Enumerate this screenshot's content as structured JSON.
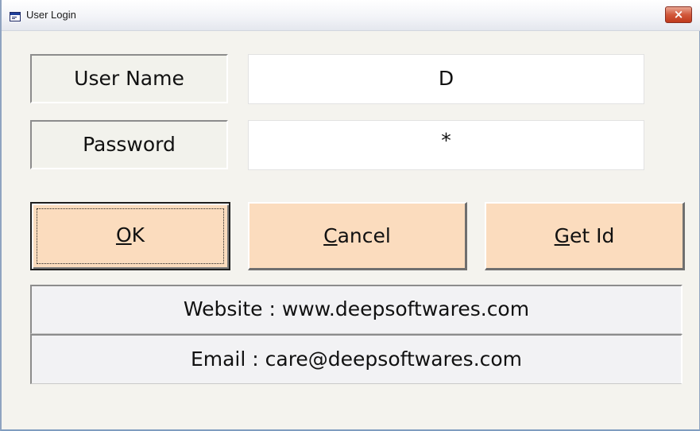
{
  "window": {
    "title": "User Login",
    "close_glyph": "×"
  },
  "form": {
    "user_name_label": "User Name",
    "user_name_value": "D",
    "password_label": "Password",
    "password_value": "*"
  },
  "buttons": {
    "ok": {
      "prefix": "",
      "accel": "O",
      "rest": "K"
    },
    "cancel": {
      "prefix": "",
      "accel": "C",
      "rest": "ancel"
    },
    "get_id": {
      "prefix": "",
      "accel": "G",
      "rest": "et Id"
    }
  },
  "info": {
    "website": "Website : www.deepsoftwares.com",
    "email": "Email : care@deepsoftwares.com"
  },
  "icons": {
    "title_icon": "window-icon",
    "close_icon": "close-icon"
  },
  "colors": {
    "button_face": "#fbdcbe",
    "dialog_face": "#f4f3ee",
    "close_button": "#c0391c"
  }
}
